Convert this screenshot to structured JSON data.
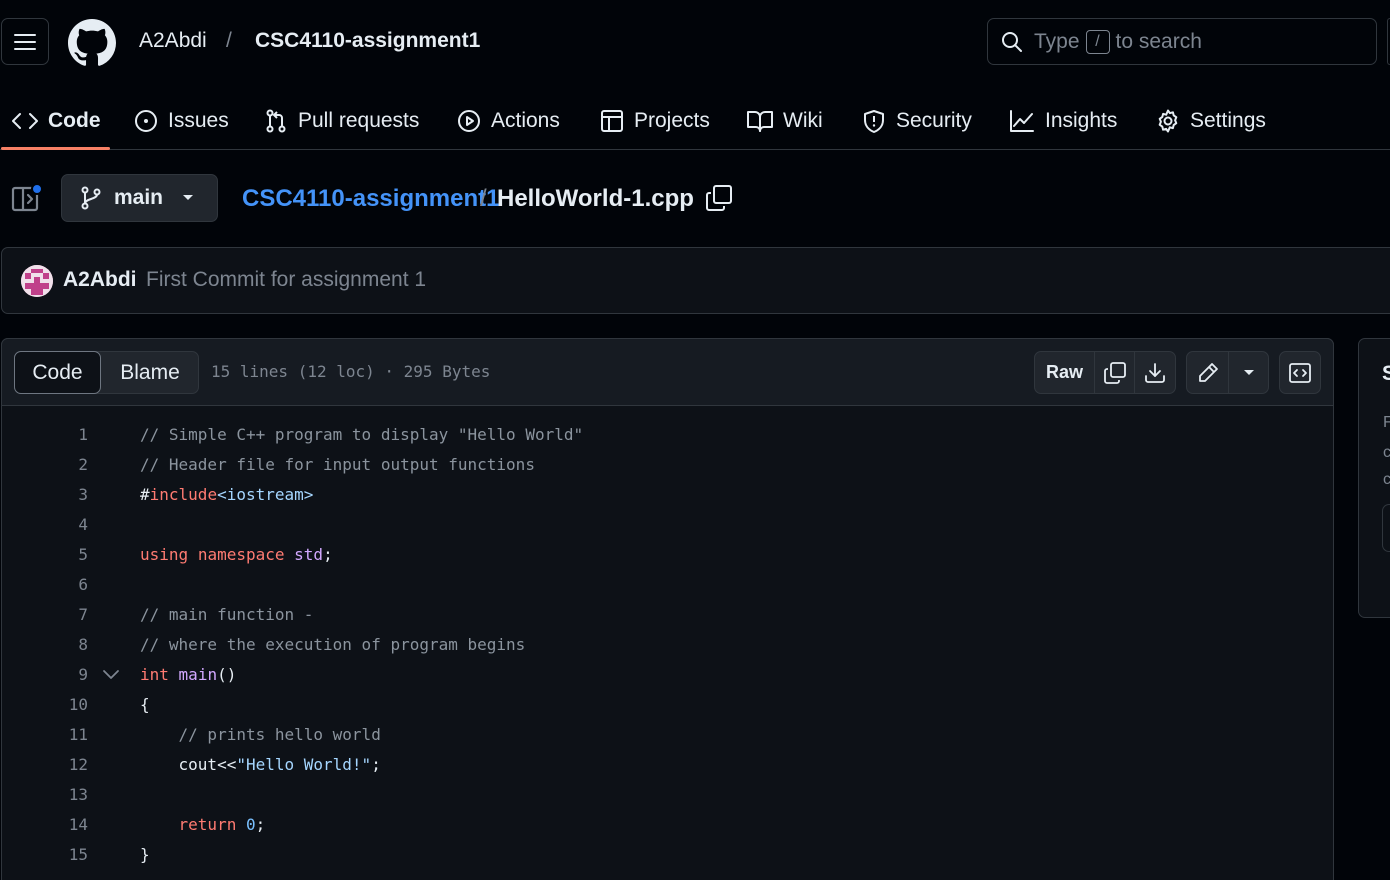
{
  "header": {
    "owner": "A2Abdi",
    "separator": "/",
    "repo": "CSC4110-assignment1",
    "search": {
      "prefix": "Type",
      "key": "/",
      "suffix": "to search"
    }
  },
  "tabs": [
    {
      "label": "Code",
      "icon": "code-icon",
      "active": true
    },
    {
      "label": "Issues",
      "icon": "issue-opened-icon"
    },
    {
      "label": "Pull requests",
      "icon": "git-pull-request-icon"
    },
    {
      "label": "Actions",
      "icon": "play-icon"
    },
    {
      "label": "Projects",
      "icon": "table-icon"
    },
    {
      "label": "Wiki",
      "icon": "book-icon"
    },
    {
      "label": "Security",
      "icon": "shield-icon"
    },
    {
      "label": "Insights",
      "icon": "graph-icon"
    },
    {
      "label": "Settings",
      "icon": "gear-icon"
    }
  ],
  "file": {
    "branch": "main",
    "repo_link": "CSC4110-assignment1",
    "separator": "/",
    "filename": "HelloWorld-1.cpp"
  },
  "commit": {
    "author": "A2Abdi",
    "message": "First Commit for assignment 1"
  },
  "viewer": {
    "tab_code": "Code",
    "tab_blame": "Blame",
    "meta": "15 lines (12 loc) · 295 Bytes",
    "raw_label": "Raw"
  },
  "code_lines": [
    {
      "n": "1",
      "text": "// Simple C++ program to display \"Hello World\""
    },
    {
      "n": "2",
      "text": "// Header file for input output functions"
    },
    {
      "n": "3",
      "text": "#include<iostream>"
    },
    {
      "n": "4",
      "text": ""
    },
    {
      "n": "5",
      "text": "using namespace std;"
    },
    {
      "n": "6",
      "text": ""
    },
    {
      "n": "7",
      "text": "// main function -"
    },
    {
      "n": "8",
      "text": "// where the execution of program begins"
    },
    {
      "n": "9",
      "text": "int main()"
    },
    {
      "n": "10",
      "text": "{"
    },
    {
      "n": "11",
      "text": "    // prints hello world"
    },
    {
      "n": "12",
      "text": "    cout<<\"Hello World!\";"
    },
    {
      "n": "13",
      "text": ""
    },
    {
      "n": "14",
      "text": "    return 0;"
    },
    {
      "n": "15",
      "text": "}"
    }
  ],
  "side_panel": {
    "heading_fragment": "S",
    "text_fragments": [
      "F",
      "c",
      "c"
    ]
  },
  "colors": {
    "background": "#010409",
    "surface": "#0d1117",
    "border": "#30363d",
    "link": "#4493f8",
    "tab_underline": "#f78166",
    "notification_dot": "#1f6feb"
  }
}
